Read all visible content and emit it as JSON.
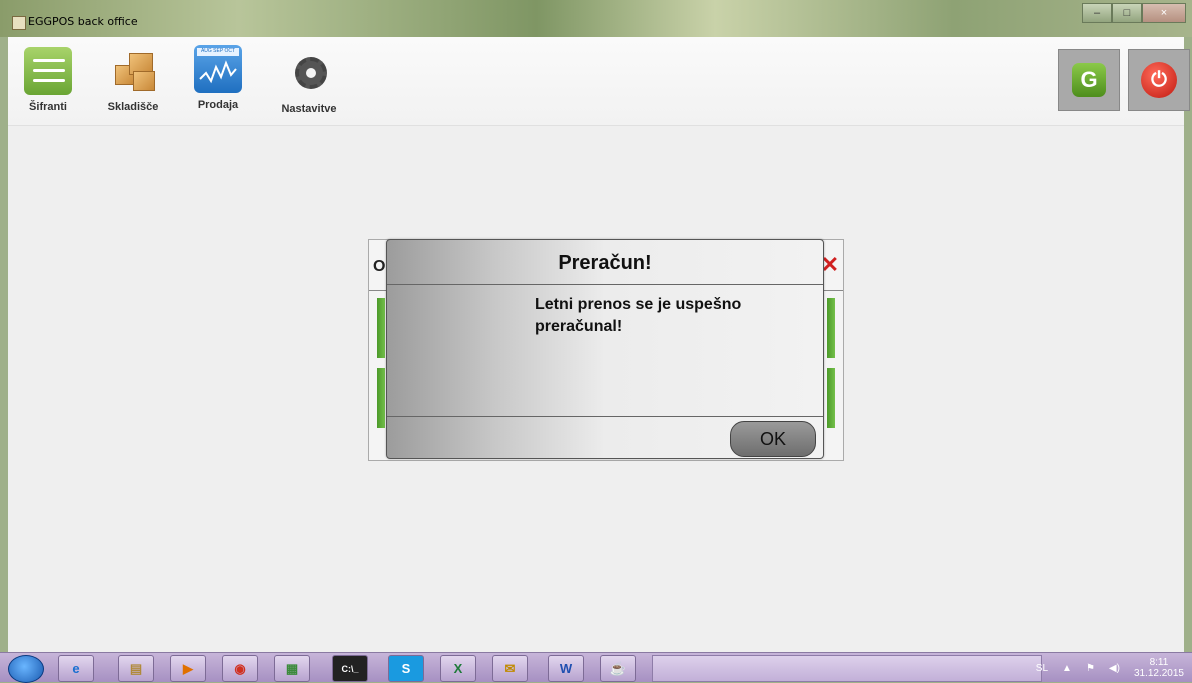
{
  "window": {
    "title": "EGGPOS back office",
    "minimize": "–",
    "maximize": "□",
    "close": "×"
  },
  "toolbar": {
    "items": [
      {
        "label": "Šifranti",
        "icon": "list-icon"
      },
      {
        "label": "Skladišče",
        "icon": "boxes-icon"
      },
      {
        "label": "Prodaja",
        "icon": "chart-icon",
        "months": "AUG SEP OCT"
      },
      {
        "label": "Nastavitve",
        "icon": "gear-icon"
      }
    ],
    "logout_icon": "G",
    "power_icon": "⏻"
  },
  "background_dialog": {
    "letter": "O",
    "close_icon": "✕"
  },
  "message": {
    "title": "Preračun!",
    "body": "Letni prenos se je uspešno preračunal!",
    "ok_label": "OK"
  },
  "taskbar": {
    "apps": [
      "e",
      "▤",
      "▶",
      "◉",
      "▦",
      "C:\\_",
      "S",
      "X",
      "✉",
      "W",
      "☕"
    ],
    "language": "SL",
    "time": "8:11",
    "date": "31.12.2015"
  }
}
